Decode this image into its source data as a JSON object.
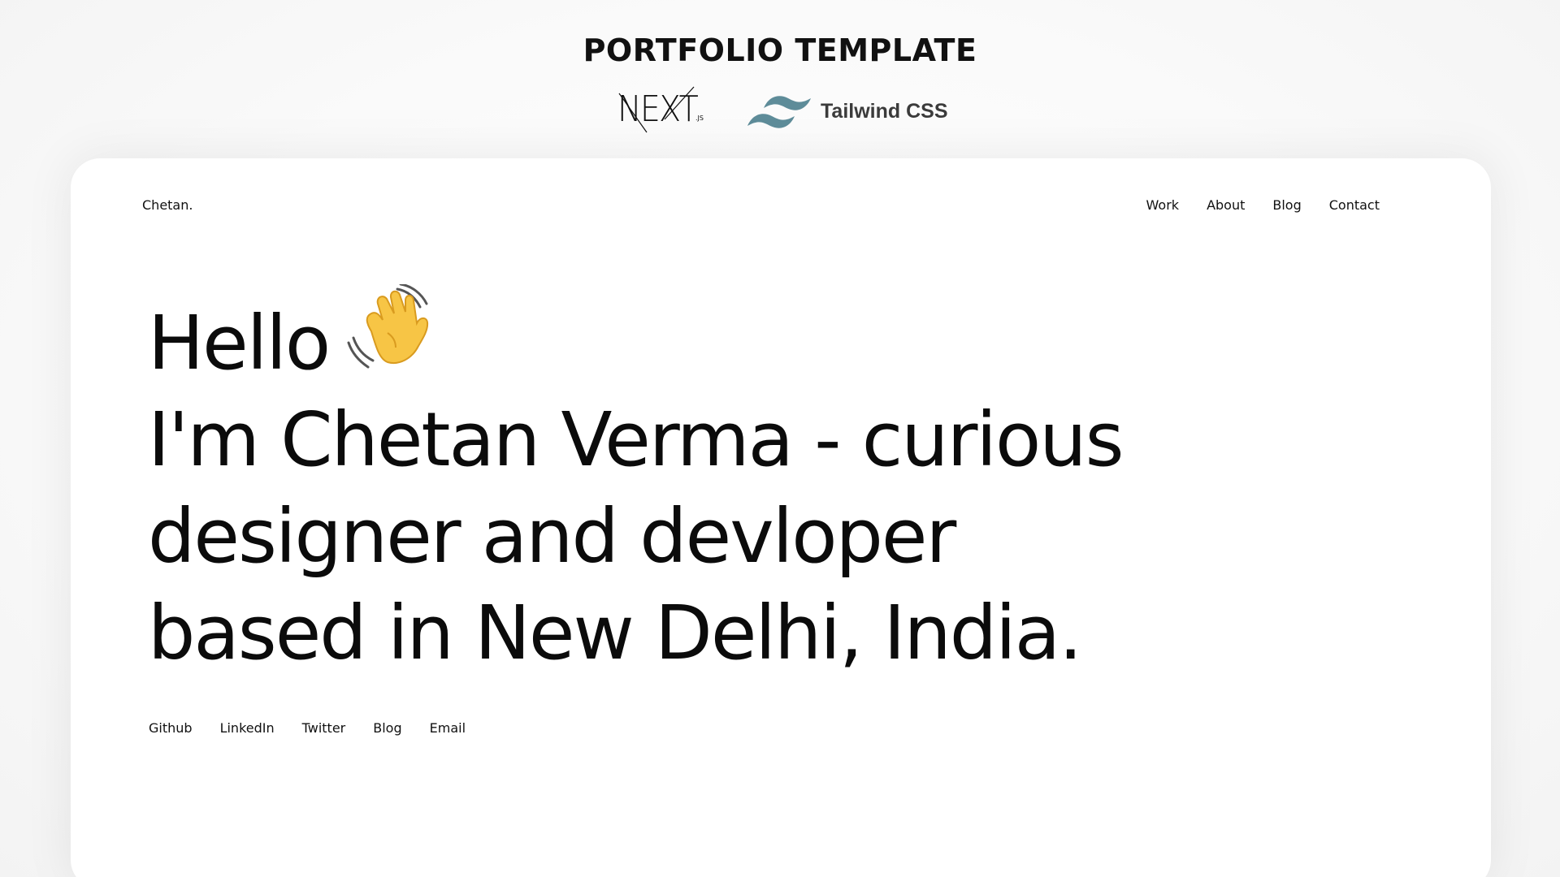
{
  "banner": {
    "title": "PORTFOLIO TEMPLATE",
    "nextjs_logo": {
      "word": "NEXT",
      "suffix": ".JS",
      "icon": "nextjs-logo-icon"
    },
    "tailwind_logo": {
      "text": "Tailwind CSS",
      "icon": "tailwind-logo-icon"
    }
  },
  "site": {
    "brand": "Chetan.",
    "nav": [
      {
        "label": "Work"
      },
      {
        "label": "About"
      },
      {
        "label": "Blog"
      },
      {
        "label": "Contact"
      }
    ],
    "hero": {
      "lines": [
        "Hello",
        "I'm Chetan Verma - curious",
        "designer and devloper",
        "based in New Delhi, India."
      ],
      "wave_icon": "waving-hand-icon"
    },
    "socials": [
      {
        "label": "Github"
      },
      {
        "label": "LinkedIn"
      },
      {
        "label": "Twitter"
      },
      {
        "label": "Blog"
      },
      {
        "label": "Email"
      }
    ]
  },
  "colors": {
    "text": "#111111",
    "tailwind_logo": "#5e8c99",
    "background": "#f8f8f8",
    "card": "#ffffff"
  }
}
